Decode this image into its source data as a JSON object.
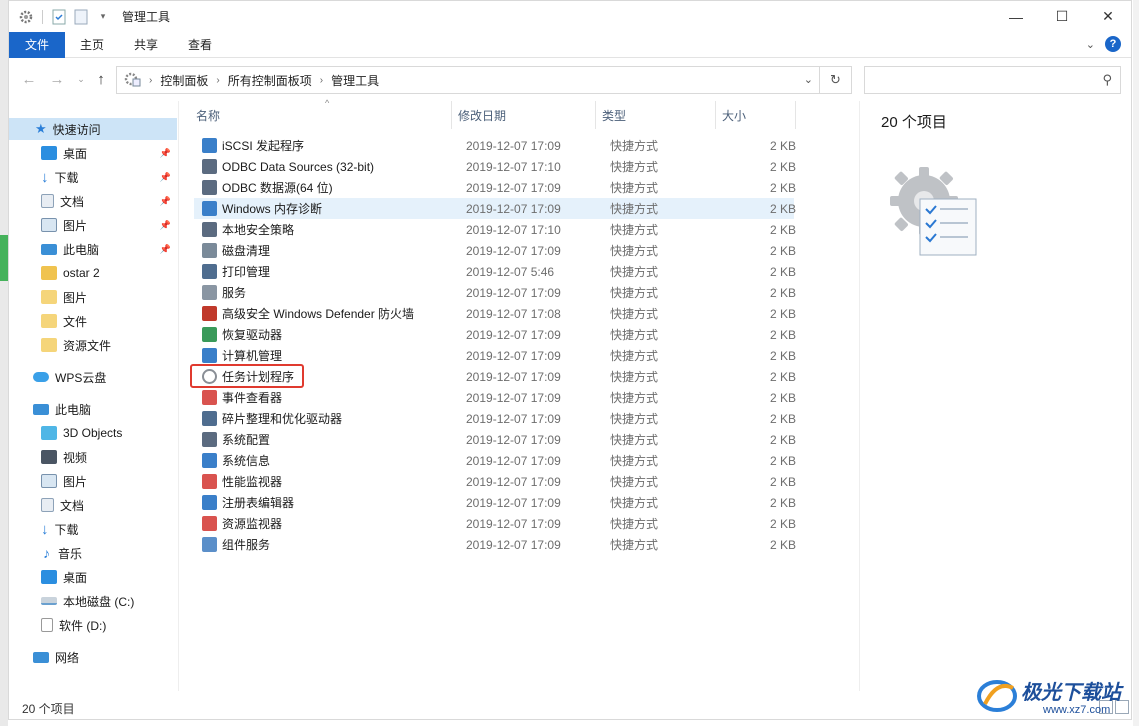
{
  "window": {
    "title": "管理工具",
    "controls": {
      "minimize": "—",
      "maximize": "☐",
      "close": "✕"
    }
  },
  "ribbon": {
    "tabs": [
      "文件",
      "主页",
      "共享",
      "查看"
    ],
    "expand_icon": "chevron-down-icon",
    "help_label": "?"
  },
  "address": {
    "crumbs": [
      "控制面板",
      "所有控制面板项",
      "管理工具"
    ],
    "search_placeholder": ""
  },
  "nav": {
    "quick_access": "快速访问",
    "quick_items": [
      {
        "label": "桌面",
        "icon": "desktop-icon",
        "pinned": true
      },
      {
        "label": "下载",
        "icon": "download-icon",
        "pinned": true
      },
      {
        "label": "文档",
        "icon": "document-icon",
        "pinned": true
      },
      {
        "label": "图片",
        "icon": "picture-icon",
        "pinned": true
      },
      {
        "label": "此电脑",
        "icon": "computer-icon",
        "pinned": true
      },
      {
        "label": "ostar 2",
        "icon": "lock-folder-icon",
        "pinned": false
      },
      {
        "label": "图片",
        "icon": "folder-icon",
        "pinned": false
      },
      {
        "label": "文件",
        "icon": "folder-icon",
        "pinned": false
      },
      {
        "label": "资源文件",
        "icon": "folder-icon",
        "pinned": false
      }
    ],
    "wps": "WPS云盘",
    "this_pc": "此电脑",
    "pc_items": [
      {
        "label": "3D Objects",
        "icon": "3d-objects-icon"
      },
      {
        "label": "视频",
        "icon": "video-icon"
      },
      {
        "label": "图片",
        "icon": "picture-icon"
      },
      {
        "label": "文档",
        "icon": "document-icon"
      },
      {
        "label": "下载",
        "icon": "download-icon"
      },
      {
        "label": "音乐",
        "icon": "music-icon"
      },
      {
        "label": "桌面",
        "icon": "desktop-icon"
      },
      {
        "label": "本地磁盘 (C:)",
        "icon": "drive-icon"
      },
      {
        "label": "软件 (D:)",
        "icon": "drive-icon"
      }
    ],
    "network": "网络"
  },
  "list": {
    "columns": {
      "name": "名称",
      "date": "修改日期",
      "type": "类型",
      "size": "大小"
    },
    "rows": [
      {
        "name": "iSCSI 发起程序",
        "date": "2019-12-07 17:09",
        "type": "快捷方式",
        "size": "2 KB"
      },
      {
        "name": "ODBC Data Sources (32-bit)",
        "date": "2019-12-07 17:10",
        "type": "快捷方式",
        "size": "2 KB"
      },
      {
        "name": "ODBC 数据源(64 位)",
        "date": "2019-12-07 17:09",
        "type": "快捷方式",
        "size": "2 KB"
      },
      {
        "name": "Windows 内存诊断",
        "date": "2019-12-07 17:09",
        "type": "快捷方式",
        "size": "2 KB"
      },
      {
        "name": "本地安全策略",
        "date": "2019-12-07 17:10",
        "type": "快捷方式",
        "size": "2 KB"
      },
      {
        "name": "磁盘清理",
        "date": "2019-12-07 17:09",
        "type": "快捷方式",
        "size": "2 KB"
      },
      {
        "name": "打印管理",
        "date": "2019-12-07 5:46",
        "type": "快捷方式",
        "size": "2 KB"
      },
      {
        "name": "服务",
        "date": "2019-12-07 17:09",
        "type": "快捷方式",
        "size": "2 KB"
      },
      {
        "name": "高级安全 Windows Defender 防火墙",
        "date": "2019-12-07 17:08",
        "type": "快捷方式",
        "size": "2 KB"
      },
      {
        "name": "恢复驱动器",
        "date": "2019-12-07 17:09",
        "type": "快捷方式",
        "size": "2 KB"
      },
      {
        "name": "计算机管理",
        "date": "2019-12-07 17:09",
        "type": "快捷方式",
        "size": "2 KB"
      },
      {
        "name": "任务计划程序",
        "date": "2019-12-07 17:09",
        "type": "快捷方式",
        "size": "2 KB"
      },
      {
        "name": "事件查看器",
        "date": "2019-12-07 17:09",
        "type": "快捷方式",
        "size": "2 KB"
      },
      {
        "name": "碎片整理和优化驱动器",
        "date": "2019-12-07 17:09",
        "type": "快捷方式",
        "size": "2 KB"
      },
      {
        "name": "系统配置",
        "date": "2019-12-07 17:09",
        "type": "快捷方式",
        "size": "2 KB"
      },
      {
        "name": "系统信息",
        "date": "2019-12-07 17:09",
        "type": "快捷方式",
        "size": "2 KB"
      },
      {
        "name": "性能监视器",
        "date": "2019-12-07 17:09",
        "type": "快捷方式",
        "size": "2 KB"
      },
      {
        "name": "注册表编辑器",
        "date": "2019-12-07 17:09",
        "type": "快捷方式",
        "size": "2 KB"
      },
      {
        "name": "资源监视器",
        "date": "2019-12-07 17:09",
        "type": "快捷方式",
        "size": "2 KB"
      },
      {
        "name": "组件服务",
        "date": "2019-12-07 17:09",
        "type": "快捷方式",
        "size": "2 KB"
      }
    ]
  },
  "preview": {
    "count_label": "20 个项目"
  },
  "status": {
    "count_label": "20 个项目"
  },
  "watermark": {
    "brand": "极光下载站",
    "url": "www.xz7.com"
  },
  "colors": {
    "accent": "#1a66c9",
    "selection": "#cde4f7",
    "hover_row": "#e5f1fb",
    "highlight_box": "#e03a2f"
  }
}
